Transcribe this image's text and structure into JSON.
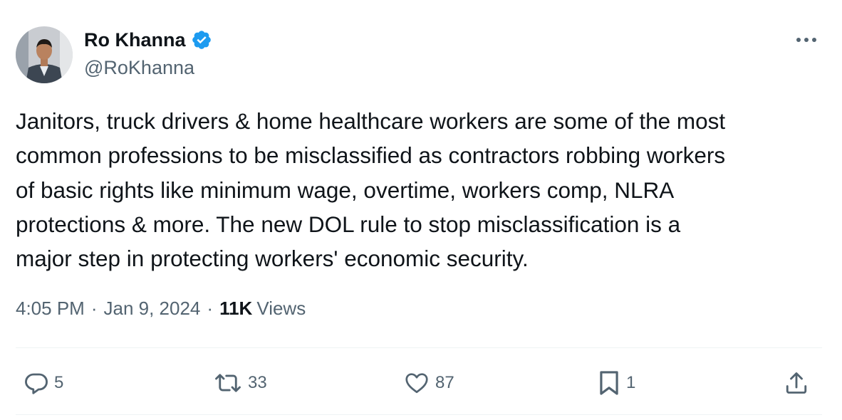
{
  "author": {
    "name": "Ro Khanna",
    "handle": "@RoKhanna",
    "verified_badge_icon": "verified-checkmark-icon",
    "verified_color": "#1d9bf0"
  },
  "more_menu_icon": "more-horizontal-icon",
  "tweet": {
    "text": "Janitors, truck drivers & home healthcare workers are some of the most\ncommon professions to be misclassified as contractors robbing workers\nof basic rights like minimum wage, overtime, workers comp, NLRA\nprotections & more. The new DOL rule to stop misclassification is a\nmajor step in protecting workers' economic security."
  },
  "meta": {
    "time": "4:05 PM",
    "separator": "·",
    "date": "Jan 9, 2024",
    "views_count": "11K",
    "views_label": "Views"
  },
  "actions": {
    "reply": {
      "icon": "reply-icon",
      "count": "5"
    },
    "retweet": {
      "icon": "retweet-icon",
      "count": "33"
    },
    "like": {
      "icon": "heart-icon",
      "count": "87"
    },
    "bookmark": {
      "icon": "bookmark-icon",
      "count": "1"
    },
    "share": {
      "icon": "share-icon"
    }
  },
  "colors": {
    "text_primary": "#0f1419",
    "text_secondary": "#536471",
    "divider": "#eff3f4"
  }
}
